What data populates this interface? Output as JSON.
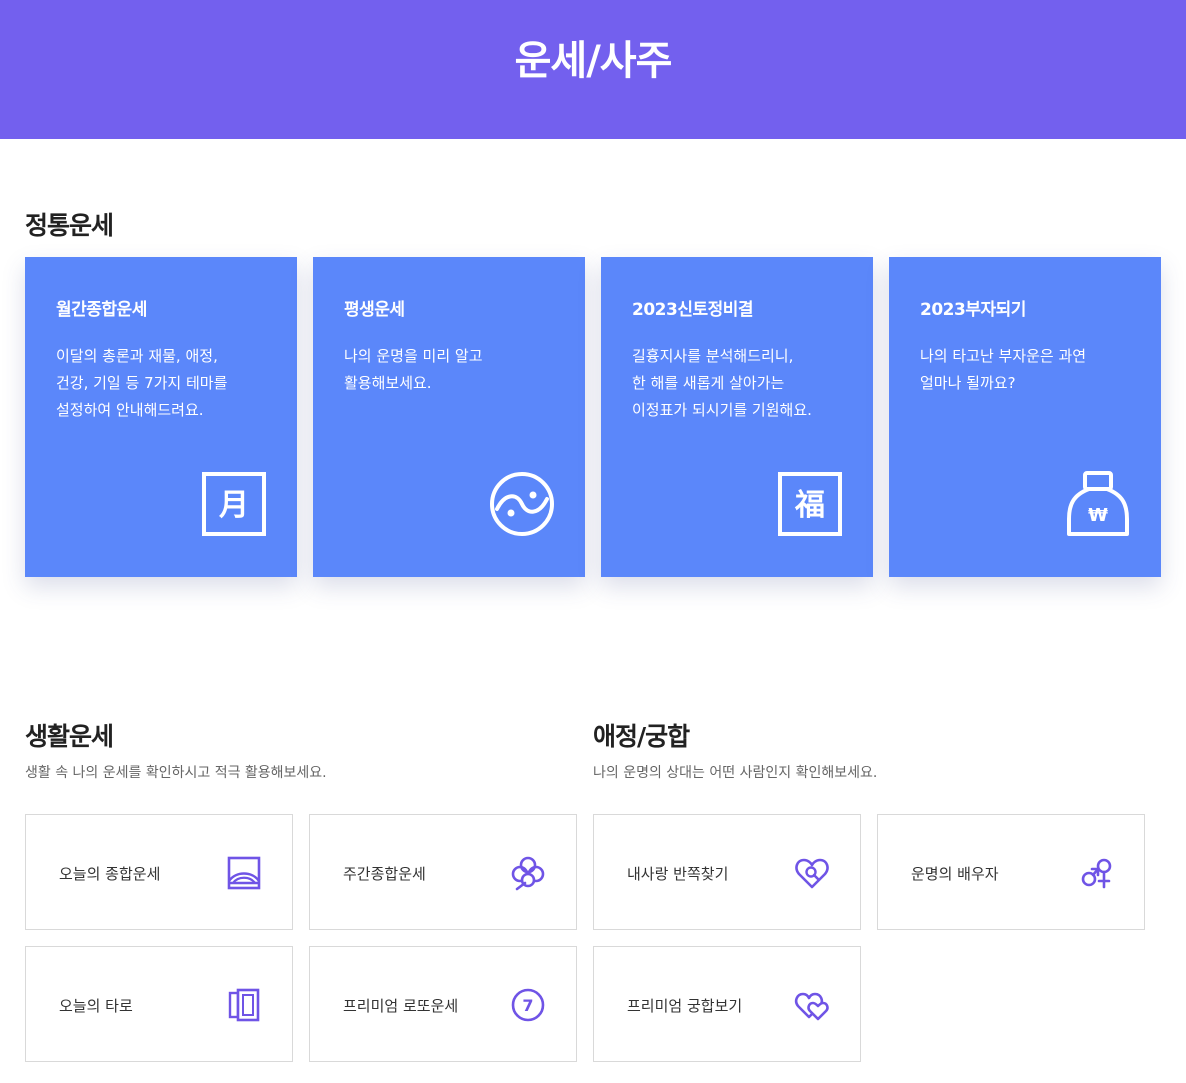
{
  "header": {
    "title": "운세/사주"
  },
  "traditional": {
    "title": "정통운세",
    "cards": [
      {
        "title": "월간종합운세",
        "desc": [
          "이달의 총론과 재물, 애정,",
          "건강, 기일 등 7가지 테마를",
          "설정하여 안내해드려요."
        ],
        "icon": "moon-month-icon",
        "glyph": "月"
      },
      {
        "title": "평생운세",
        "desc": [
          "나의 운명을 미리 알고",
          "활용해보세요."
        ],
        "icon": "yin-yang-icon"
      },
      {
        "title": "2023신토정비결",
        "desc": [
          "길흉지사를 분석해드리니,",
          "한 해를 새롭게 살아가는",
          "이정표가 되시기를 기원해요."
        ],
        "icon": "fortune-bok-icon",
        "glyph": "福"
      },
      {
        "title": "2023부자되기",
        "desc": [
          "나의 타고난 부자운은 과연",
          "얼마나 될까요?"
        ],
        "icon": "money-bag-icon",
        "glyph": "₩"
      }
    ]
  },
  "daily": {
    "title": "생활운세",
    "desc": "생활 속 나의 운세를 확인하시고 적극 활용해보세요.",
    "items": [
      {
        "label": "오늘의 종합운세",
        "icon": "sunrise-frame-icon"
      },
      {
        "label": "주간종합운세",
        "icon": "clover-icon"
      },
      {
        "label": "오늘의 타로",
        "icon": "tarot-cards-icon"
      },
      {
        "label": "프리미엄 로또운세",
        "icon": "lucky-seven-icon",
        "glyph": "7"
      }
    ]
  },
  "love": {
    "title": "애정/궁합",
    "desc": "나의 운명의 상대는 어떤 사람인지 확인해보세요.",
    "items": [
      {
        "label": "내사랑 반쪽찾기",
        "icon": "heart-search-icon"
      },
      {
        "label": "운명의 배우자",
        "icon": "gender-symbols-icon"
      },
      {
        "label": "프리미엄 궁합보기",
        "icon": "double-heart-icon"
      }
    ]
  },
  "colors": {
    "header": "#7360ee",
    "card": "#5b87fa",
    "accent": "#6f54e6"
  }
}
